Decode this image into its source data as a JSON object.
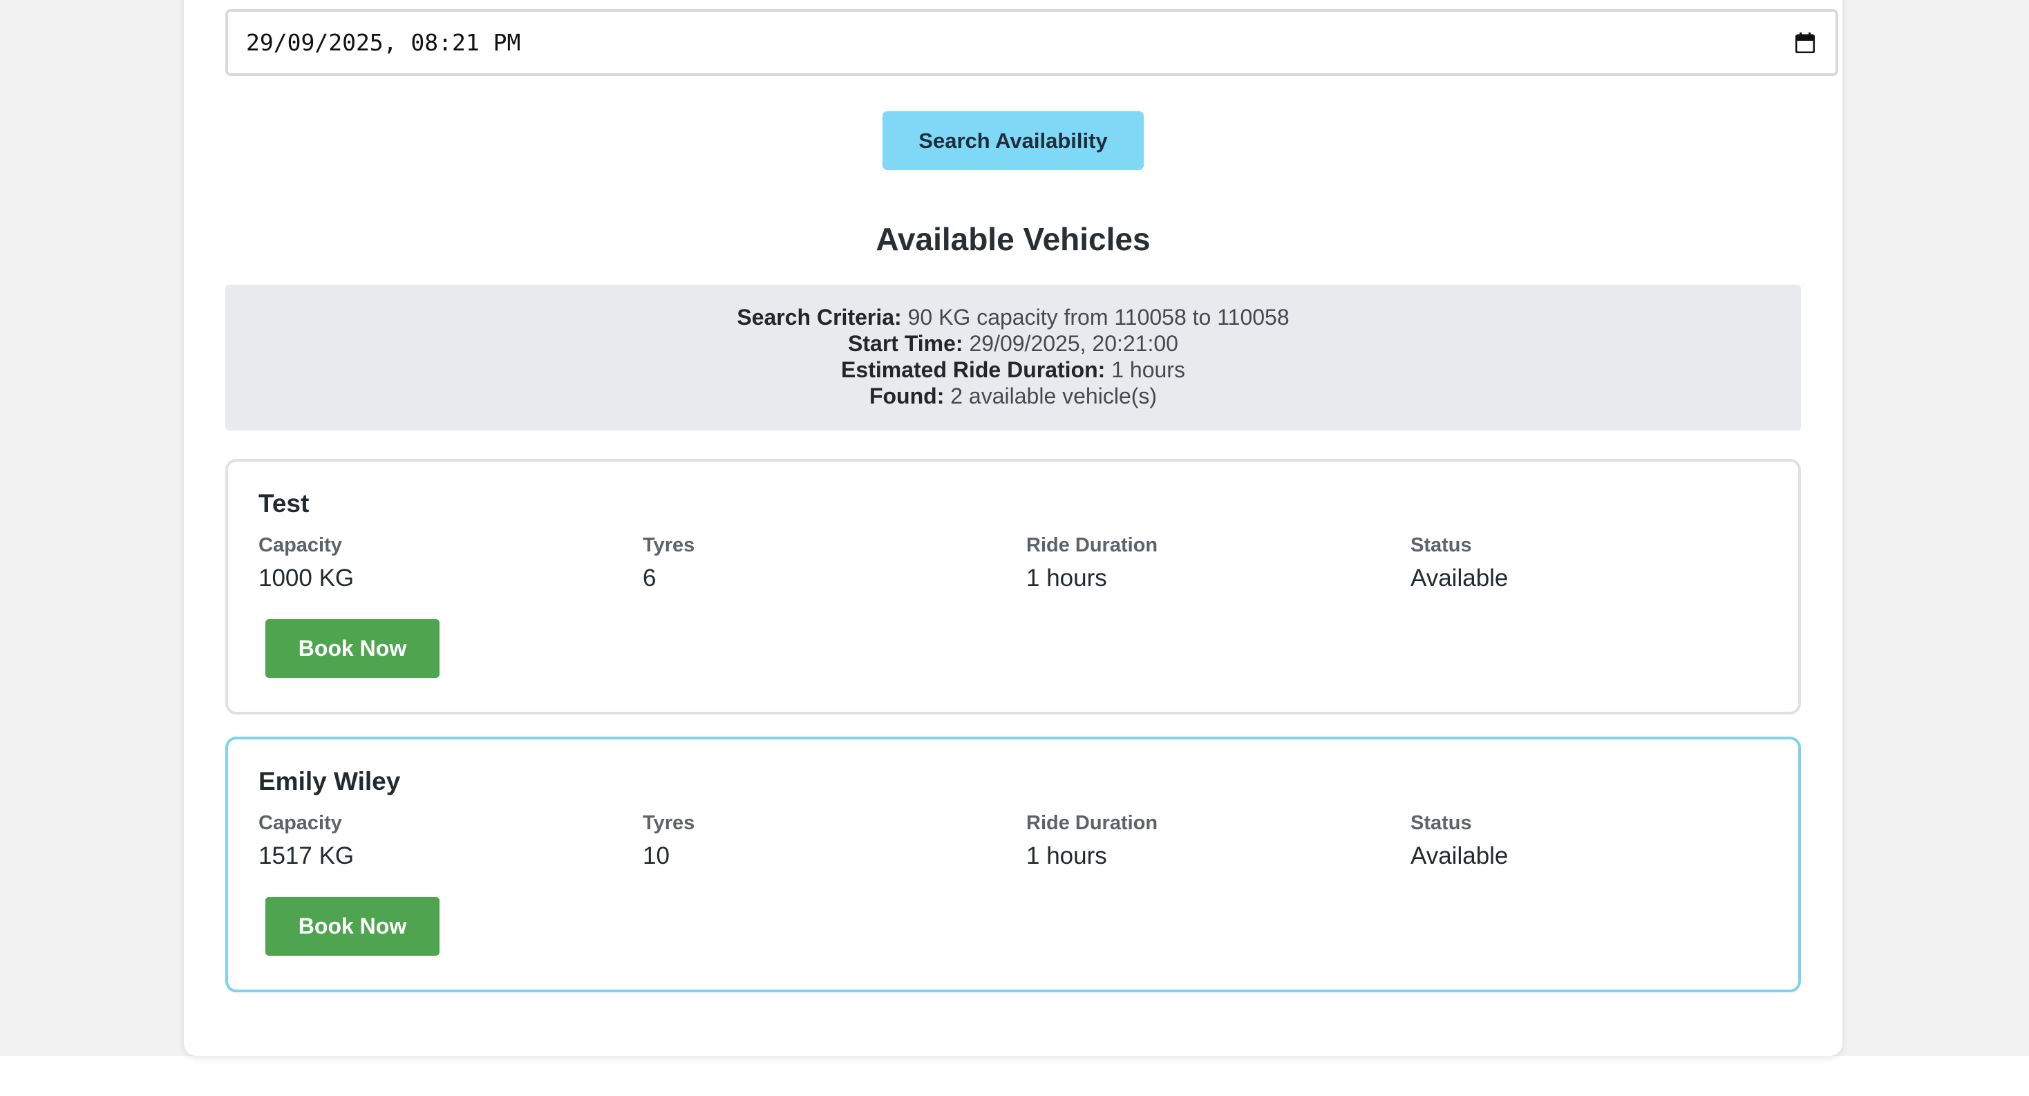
{
  "datetime_input": {
    "value": "29/09/2025, 08:21 PM",
    "icon": "calendar-icon"
  },
  "search": {
    "button_label": "Search Availability",
    "button_color": "#7fd8f6"
  },
  "results": {
    "title": "Available Vehicles",
    "criteria": {
      "search_criteria_label": "Search Criteria:",
      "search_criteria_value": "90 KG capacity from 110058 to 110058",
      "start_time_label": "Start Time:",
      "start_time_value": "29/09/2025, 20:21:00",
      "duration_label": "Estimated Ride Duration:",
      "duration_value": "1 hours",
      "found_label": "Found:",
      "found_value": "2 available vehicle(s)"
    },
    "field_labels": {
      "capacity": "Capacity",
      "tyres": "Tyres",
      "ride_duration": "Ride Duration",
      "status": "Status"
    },
    "book_label": "Book Now",
    "book_color": "#4fa54f",
    "highlight_border_color": "#7fd3ee",
    "vehicles": [
      {
        "name": "Test",
        "capacity": "1000 KG",
        "tyres": "6",
        "ride_duration": "1 hours",
        "status": "Available"
      },
      {
        "name": "Emily Wiley",
        "capacity": "1517 KG",
        "tyres": "10",
        "ride_duration": "1 hours",
        "status": "Available"
      }
    ]
  }
}
